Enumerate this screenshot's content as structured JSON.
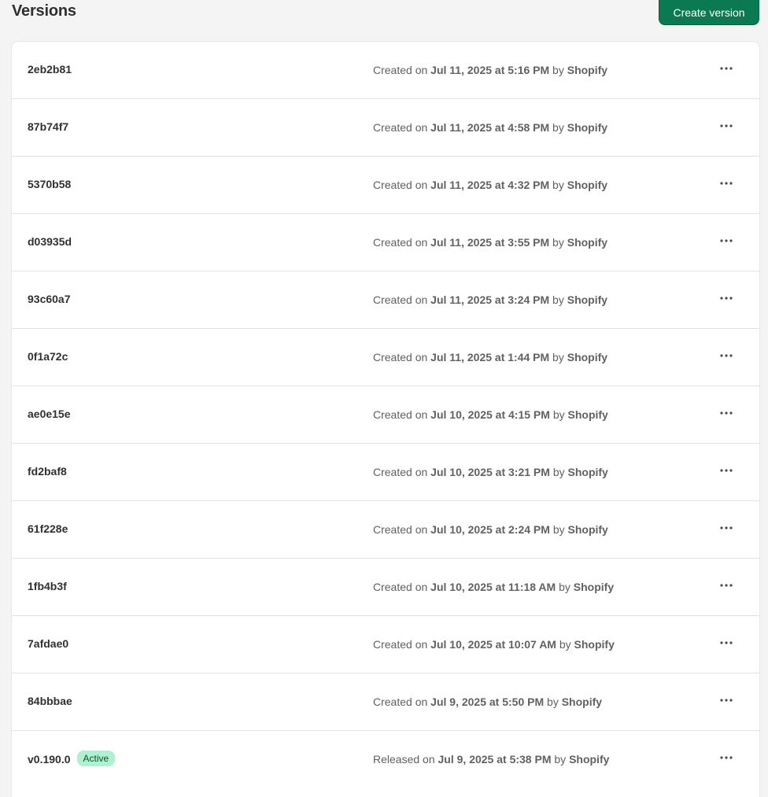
{
  "header": {
    "title": "Versions",
    "create_label": "Create version"
  },
  "versions": [
    {
      "id": "2eb2b81",
      "prefix": "Created on",
      "date": "Jul 11, 2025 at 5:16 PM",
      "by": "by",
      "author": "Shopify",
      "badge": ""
    },
    {
      "id": "87b74f7",
      "prefix": "Created on",
      "date": "Jul 11, 2025 at 4:58 PM",
      "by": "by",
      "author": "Shopify",
      "badge": ""
    },
    {
      "id": "5370b58",
      "prefix": "Created on",
      "date": "Jul 11, 2025 at 4:32 PM",
      "by": "by",
      "author": "Shopify",
      "badge": ""
    },
    {
      "id": "d03935d",
      "prefix": "Created on",
      "date": "Jul 11, 2025 at 3:55 PM",
      "by": "by",
      "author": "Shopify",
      "badge": ""
    },
    {
      "id": "93c60a7",
      "prefix": "Created on",
      "date": "Jul 11, 2025 at 3:24 PM",
      "by": "by",
      "author": "Shopify",
      "badge": ""
    },
    {
      "id": "0f1a72c",
      "prefix": "Created on",
      "date": "Jul 11, 2025 at 1:44 PM",
      "by": "by",
      "author": "Shopify",
      "badge": ""
    },
    {
      "id": "ae0e15e",
      "prefix": "Created on",
      "date": "Jul 10, 2025 at 4:15 PM",
      "by": "by",
      "author": "Shopify",
      "badge": ""
    },
    {
      "id": "fd2baf8",
      "prefix": "Created on",
      "date": "Jul 10, 2025 at 3:21 PM",
      "by": "by",
      "author": "Shopify",
      "badge": ""
    },
    {
      "id": "61f228e",
      "prefix": "Created on",
      "date": "Jul 10, 2025 at 2:24 PM",
      "by": "by",
      "author": "Shopify",
      "badge": ""
    },
    {
      "id": "1fb4b3f",
      "prefix": "Created on",
      "date": "Jul 10, 2025 at 11:18 AM",
      "by": "by",
      "author": "Shopify",
      "badge": ""
    },
    {
      "id": "7afdae0",
      "prefix": "Created on",
      "date": "Jul 10, 2025 at 10:07 AM",
      "by": "by",
      "author": "Shopify",
      "badge": ""
    },
    {
      "id": "84bbbae",
      "prefix": "Created on",
      "date": "Jul 9, 2025 at 5:50 PM",
      "by": "by",
      "author": "Shopify",
      "badge": ""
    },
    {
      "id": "v0.190.0",
      "prefix": "Released on",
      "date": "Jul 9, 2025 at 5:38 PM",
      "by": "by",
      "author": "Shopify",
      "badge": "Active"
    }
  ],
  "icons": {
    "row_action": "more-horizontal-icon"
  },
  "colors": {
    "primary_button": "#0b7a52",
    "active_badge_bg": "#aff0d1",
    "active_badge_text": "#0c5132"
  }
}
